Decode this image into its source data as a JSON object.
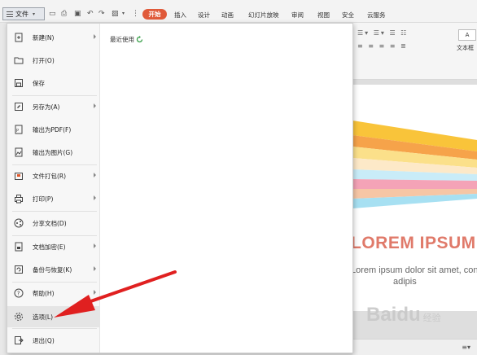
{
  "topbar": {
    "file_menu_label": "文件",
    "tabs": [
      "开始",
      "插入",
      "设计",
      "动画",
      "幻灯片放映",
      "审阅",
      "视图",
      "安全",
      "云服务"
    ]
  },
  "ribbon": {
    "textbox_label": "A",
    "textbox_caption": "文本框"
  },
  "file_menu": {
    "items": [
      {
        "label": "新建(N)",
        "icon": "new-document-icon",
        "submenu": true
      },
      {
        "label": "打开(O)",
        "icon": "folder-open-icon",
        "submenu": false
      },
      {
        "label": "保存",
        "icon": "save-icon",
        "submenu": false
      },
      {
        "label": "另存为(A)",
        "icon": "save-as-icon",
        "submenu": true
      },
      {
        "label": "输出为PDF(F)",
        "icon": "export-pdf-icon",
        "submenu": false
      },
      {
        "label": "输出为图片(G)",
        "icon": "export-image-icon",
        "submenu": false
      },
      {
        "label": "文件打包(R)",
        "icon": "package-icon",
        "submenu": true
      },
      {
        "label": "打印(P)",
        "icon": "print-icon",
        "submenu": true
      },
      {
        "label": "分享文档(D)",
        "icon": "share-icon",
        "submenu": false
      },
      {
        "label": "文档加密(E)",
        "icon": "encrypt-icon",
        "submenu": true
      },
      {
        "label": "备份与恢复(K)",
        "icon": "backup-icon",
        "submenu": true
      },
      {
        "label": "帮助(H)",
        "icon": "help-icon",
        "submenu": true
      },
      {
        "label": "选项(L)",
        "icon": "gear-icon",
        "submenu": false
      },
      {
        "label": "退出(Q)",
        "icon": "exit-icon",
        "submenu": false
      }
    ],
    "selected_item": "选项(L)",
    "recent_label": "最近使用"
  },
  "slide": {
    "title": "LOREM IPSUM",
    "subtitle_line1": "Lorem ipsum dolor sit amet, consectetur",
    "subtitle_line2": "adipis"
  },
  "watermark": {
    "text": "Baidu",
    "suffix": "经验"
  },
  "colors": {
    "accent_tab": "#e05a3a",
    "annotation_arrow": "#e02020",
    "title_color": "#e07a6a"
  }
}
